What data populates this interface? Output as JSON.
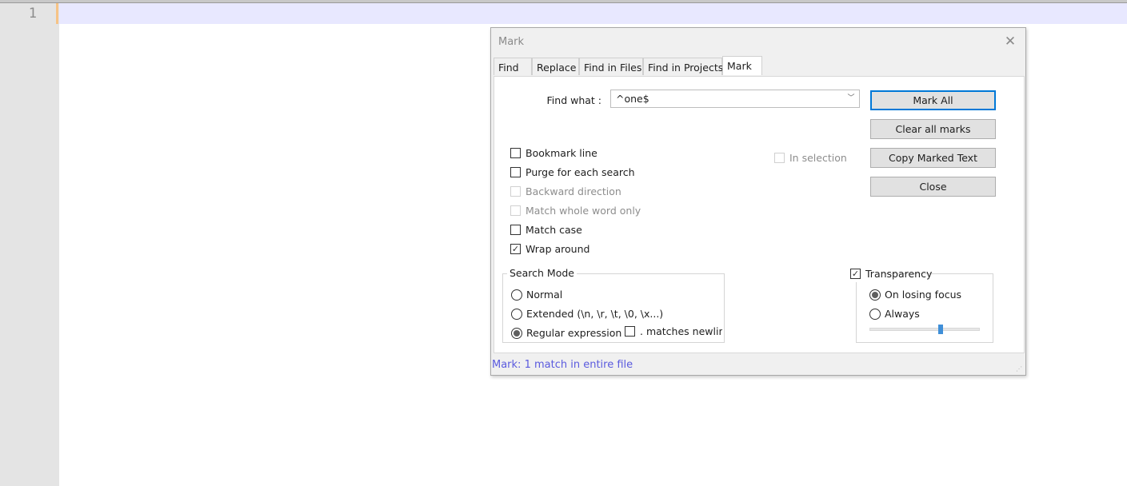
{
  "editor": {
    "line_number": "1"
  },
  "dialog": {
    "title": "Mark",
    "tabs": [
      {
        "label": "Find"
      },
      {
        "label": "Replace"
      },
      {
        "label": "Find in Files"
      },
      {
        "label": "Find in Projects"
      },
      {
        "label": "Mark"
      }
    ],
    "find_what_label": "Find what :",
    "find_what_value": "^one$",
    "buttons": {
      "mark_all": "Mark All",
      "clear_all_marks": "Clear all marks",
      "copy_marked_text": "Copy Marked Text",
      "close": "Close"
    },
    "options": {
      "bookmark_line": "Bookmark line",
      "purge": "Purge for each search",
      "backward": "Backward direction",
      "whole_word": "Match whole word only",
      "match_case": "Match case",
      "wrap_around": "Wrap around",
      "in_selection": "In selection"
    },
    "search_mode": {
      "title": "Search Mode",
      "normal": "Normal",
      "extended": "Extended (\\n, \\r, \\t, \\0, \\x...)",
      "regex": "Regular expression",
      "matches_newline": ". matches newline"
    },
    "transparency": {
      "title": "Transparency",
      "on_losing_focus": "On losing focus",
      "always": "Always",
      "level": 0.65
    },
    "status": "Mark: 1 match in entire file"
  }
}
